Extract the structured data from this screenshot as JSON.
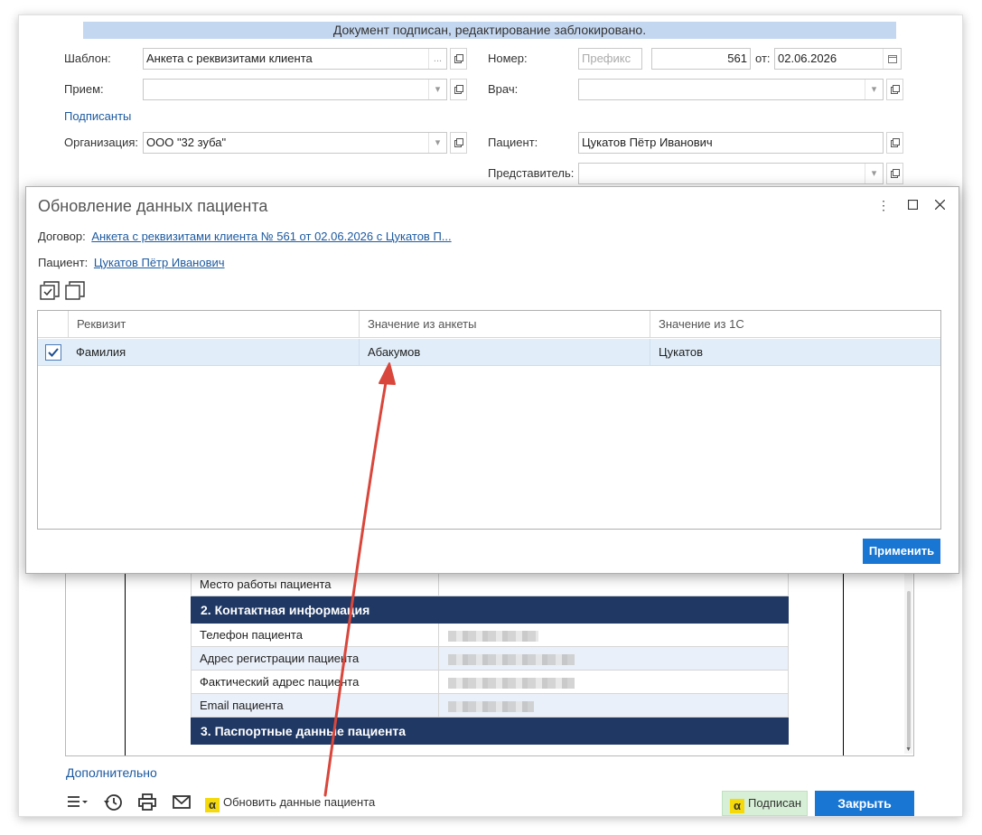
{
  "window": {
    "banner": "Документ подписан, редактирование заблокировано.",
    "template_label": "Шаблон:",
    "template_value": "Анкета с реквизитами клиента",
    "template_ellipsis": "...",
    "number_label": "Номер:",
    "prefix_placeholder": "Префикс",
    "number_value": "561",
    "from_label": "от:",
    "date_value": "02.06.2026",
    "reception_label": "Прием:",
    "doctor_label": "Врач:",
    "signers_link": "Подписанты",
    "organization_label": "Организация:",
    "organization_value": "ООО \"32 зуба\"",
    "patient_label": "Пациент:",
    "patient_value": "Цукатов Пётр Иванович",
    "representative_label": "Представитель:"
  },
  "document": {
    "rows": [
      {
        "label": "Место работы пациента",
        "type": "plain",
        "blurred": false
      },
      {
        "label": "2. Контактная информация",
        "type": "header"
      },
      {
        "label": "Телефон пациента",
        "type": "plain",
        "blurred": true
      },
      {
        "label": "Адрес регистрации пациента",
        "type": "alt",
        "blurred": true
      },
      {
        "label": "Фактический адрес пациента",
        "type": "plain",
        "blurred": true
      },
      {
        "label": "Email пациента",
        "type": "alt",
        "blurred": true
      },
      {
        "label": "3. Паспортные данные пациента",
        "type": "header"
      }
    ]
  },
  "footer": {
    "additional_link": "Дополнительно",
    "update_label": "Обновить данные пациента",
    "logo_glyph": "α",
    "sign_button": "Подписан",
    "close_button": "Закрыть"
  },
  "dialog": {
    "title": "Обновление данных пациента",
    "contract_label": "Договор:",
    "contract_link": "Анкета с реквизитами клиента № 561 от 02.06.2026 с Цукатов П...",
    "patient_label": "Пациент:",
    "patient_link": "Цукатов Пётр Иванович",
    "columns": [
      "Реквизит",
      "Значение из анкеты",
      "Значение из 1С"
    ],
    "rows": [
      {
        "checked": true,
        "field": "Фамилия",
        "form_value": "Абакумов",
        "db_value": "Цукатов"
      }
    ],
    "apply_button": "Применить"
  },
  "colors": {
    "accent": "#1976d2",
    "banner": "#c4d7f0",
    "section_header": "#1f3864",
    "selected_row": "#e1eefa",
    "annotation_arrow": "#d9463b"
  }
}
